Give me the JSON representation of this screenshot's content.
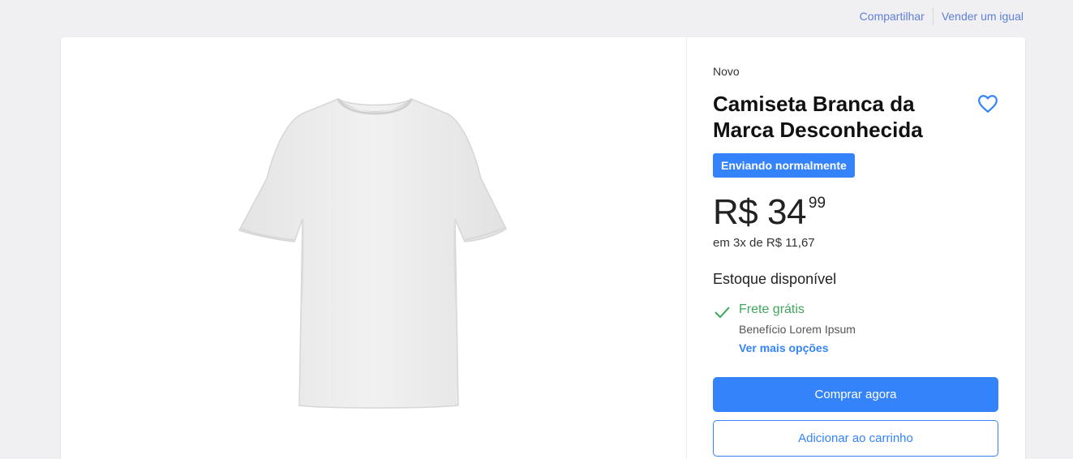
{
  "header": {
    "share_label": "Compartilhar",
    "sell_label": "Vender um igual"
  },
  "product": {
    "condition": "Novo",
    "title": "Camiseta Branca da Marca Desconhecida",
    "shipping_badge": "Enviando normalmente",
    "price_main": "R$ 34",
    "price_cents": "99",
    "installments": "em 3x de R$ 11,67",
    "stock": "Estoque disponível",
    "image_icon": "white-tshirt-image",
    "favorite_icon": "heart-outline-icon"
  },
  "shipping": {
    "title": "Frete grátis",
    "subtitle": "Benefício Lorem Ipsum",
    "more_label": "Ver mais opções",
    "icon": "check-icon"
  },
  "actions": {
    "buy_label": "Comprar agora",
    "cart_label": "Adicionar ao carrinho"
  },
  "colors": {
    "accent": "#3483fa",
    "link": "#5f7fd6",
    "success": "#3ea85a",
    "background": "#f0f0f3"
  }
}
